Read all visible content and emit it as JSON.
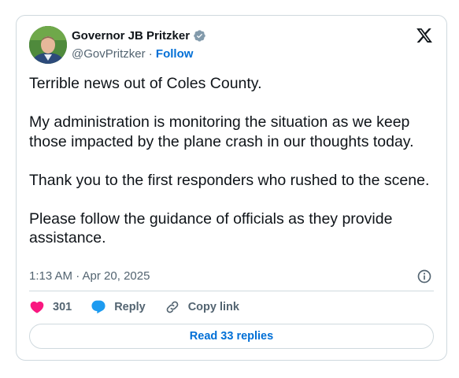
{
  "author": {
    "name": "Governor JB Pritzker",
    "handle": "@GovPritzker",
    "separator": "·",
    "follow_label": "Follow",
    "verified_badge_color": "#829aab"
  },
  "brand_icon": "x-logo-icon",
  "tweet": {
    "paragraphs": [
      "Terrible news out of Coles County.",
      "My administration is monitoring the situation as we keep those impacted by the plane crash in our thoughts today.",
      "Thank you to the first responders who rushed to the scene.",
      "Please follow the guidance of officials as they provide assistance."
    ],
    "timestamp": "1:13 AM · Apr 20, 2025"
  },
  "actions": {
    "like_count": "301",
    "reply_label": "Reply",
    "copy_label": "Copy link"
  },
  "read_replies_label": "Read 33 replies",
  "colors": {
    "accent": "#006fd6",
    "like": "#f91880",
    "reply": "#1d9bf0",
    "muted": "#536471",
    "border": "#cfd9de"
  }
}
